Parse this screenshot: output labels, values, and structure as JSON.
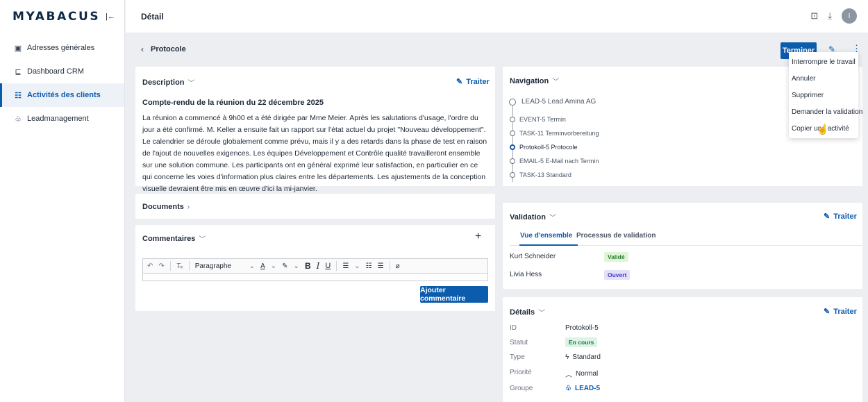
{
  "app": {
    "logo": "MYABACUS"
  },
  "sidebar": {
    "collapse_icon": "collapse-left-icon",
    "items": [
      {
        "label": "Adresses générales",
        "icon": "address-card-icon",
        "glyph": "▣"
      },
      {
        "label": "Dashboard CRM",
        "icon": "chart-icon",
        "glyph": "⊑"
      },
      {
        "label": "Activités des clients",
        "icon": "checklist-icon",
        "glyph": "☷"
      },
      {
        "label": "Leadmanagement",
        "icon": "people-icon",
        "glyph": "♧"
      }
    ],
    "active_index": 2
  },
  "topbar": {
    "title": "Détail",
    "avatar_initial": "I"
  },
  "subheader": {
    "title": "Protocole",
    "primary_button": "Terminer"
  },
  "menu": {
    "items": [
      "Interrompre le travail",
      "Annuler",
      "Supprimer",
      "Demander la validation",
      "Copier une activité"
    ]
  },
  "description": {
    "title": "Description",
    "action": "Traiter",
    "heading": "Compte-rendu de la réunion du 22 décembre 2025",
    "body": "La réunion a commencé à 9h00 et a été dirigée par Mme Meier. Après les salutations d'usage, l'ordre du jour a été confirmé. M. Keller a ensuite fait un rapport sur l'état actuel du projet \"Nouveau développement\". Le calendrier se déroule globalement comme prévu, mais il y a des retards dans la phase de test en raison de l'ajout de nouvelles exigences. Les équipes Développement et Contrôle qualité travailleront ensemble sur une solution commune. Les participants ont en général exprimé leur satisfaction, en particulier en ce qui concerne les voies d'information plus claires entre les départements. Les ajustements de la conception visuelle devraient être mis en œuvre d'ici la mi-janvier."
  },
  "documents": {
    "title": "Documents"
  },
  "comments": {
    "title": "Commentaires",
    "paragraph_select": "Paragraphe",
    "submit": "Ajouter commentaire"
  },
  "navigation": {
    "title": "Navigation",
    "items": [
      "LEAD-5 Lead Amina AG",
      "EVENT-5 Termin",
      "TASK-11 Terminvorbereitung",
      "Protokoll-5 Protocole",
      "EMAIL-5 E-Mail nach Termin",
      "TASK-13 Standard"
    ],
    "current_index": 3
  },
  "validation": {
    "title": "Validation",
    "action": "Traiter",
    "tabs": [
      "Vue d'ensemble",
      "Processus de validation"
    ],
    "rows": [
      {
        "name": "Kurt Schneider",
        "status": "Validé"
      },
      {
        "name": "Livia Hess",
        "status": "Ouvert"
      }
    ]
  },
  "details": {
    "title": "Détails",
    "action": "Traiter",
    "fields": [
      {
        "label": "ID",
        "value": "Protokoll-5"
      },
      {
        "label": "Statut",
        "value": "En cours"
      },
      {
        "label": "Type",
        "value": "Standard"
      },
      {
        "label": "Priorité",
        "value": "Normal"
      },
      {
        "label": "Groupe",
        "value": "LEAD-5"
      }
    ]
  }
}
